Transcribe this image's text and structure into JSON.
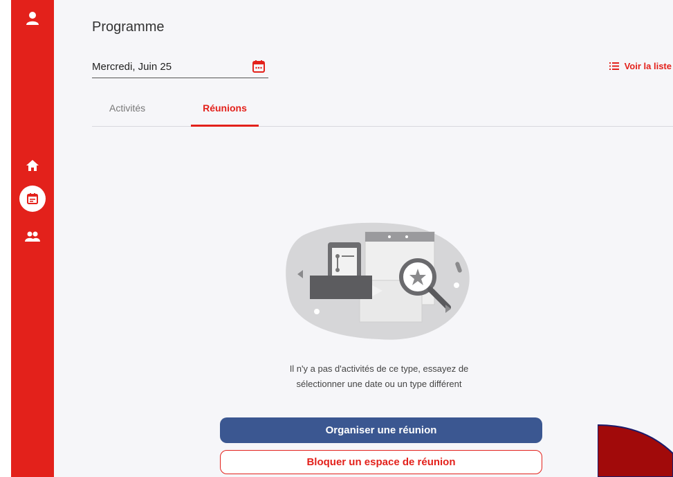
{
  "header": {
    "title": "Programme"
  },
  "date_picker": {
    "value": "Mercredi, Juin 25"
  },
  "list_link": {
    "label": "Voir la liste"
  },
  "tabs": [
    {
      "label": "Activités",
      "active": false
    },
    {
      "label": "Réunions",
      "active": true
    }
  ],
  "empty_state": {
    "line1": "Il n'y a pas d'activités de ce type, essayez de",
    "line2": "sélectionner une date ou un type différent"
  },
  "actions": {
    "primary": "Organiser une réunion",
    "secondary": "Bloquer un espace de réunion"
  },
  "colors": {
    "accent": "#e3211b",
    "primary_button": "#3b5791",
    "background": "#f6f6f9"
  },
  "icons": [
    "user-icon",
    "home-icon",
    "calendar-icon",
    "people-icon",
    "list-icon"
  ]
}
